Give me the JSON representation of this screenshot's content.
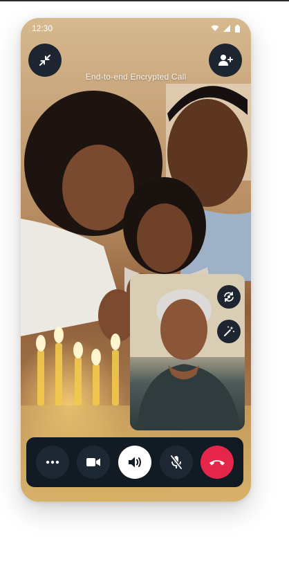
{
  "status_bar": {
    "time": "12:30",
    "icons": [
      "wifi-icon",
      "cellular-signal-icon",
      "battery-icon"
    ]
  },
  "call": {
    "title": "End-to-end Encrypted Call"
  },
  "header_buttons": [
    {
      "name": "minimize-call-button",
      "icon": "collapse-arrows-icon"
    },
    {
      "name": "add-participant-button",
      "icon": "add-person-icon"
    }
  ],
  "self_view": {
    "buttons": [
      {
        "name": "flip-camera-button",
        "icon": "camera-flip-icon"
      },
      {
        "name": "effects-button",
        "icon": "magic-wand-icon"
      }
    ]
  },
  "controls": [
    {
      "name": "more-options-button",
      "icon": "ellipsis-icon"
    },
    {
      "name": "video-toggle-button",
      "icon": "video-camera-icon"
    },
    {
      "name": "speaker-button",
      "icon": "speaker-icon",
      "active": true
    },
    {
      "name": "mute-button",
      "icon": "microphone-muted-icon"
    },
    {
      "name": "end-call-button",
      "icon": "hang-up-icon"
    }
  ],
  "colors": {
    "accent_dark": "#1c2530",
    "control_bar": "#121a24",
    "end_call": "#e5264a"
  }
}
